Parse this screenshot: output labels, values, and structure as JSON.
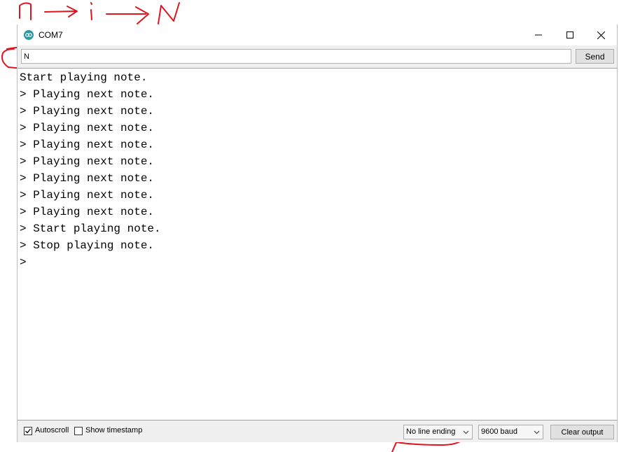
{
  "annotation": {
    "text": "n → i → N",
    "color": "#e0141e"
  },
  "window": {
    "title": "COM7",
    "icon": "arduino-icon",
    "controls": [
      "minimize-icon",
      "maximize-icon",
      "close-icon"
    ]
  },
  "input": {
    "value": "N",
    "send_label": "Send"
  },
  "output": {
    "lines": [
      "Start playing note.",
      "> Playing next note.",
      "> Playing next note.",
      "> Playing next note.",
      "> Playing next note.",
      "> Playing next note.",
      "> Playing next note.",
      "> Playing next note.",
      "> Playing next note.",
      "> Start playing note.",
      "> Stop playing note.",
      ">"
    ]
  },
  "status": {
    "autoscroll_label": "Autoscroll",
    "autoscroll_checked": true,
    "timestamp_label": "Show timestamp",
    "timestamp_checked": false,
    "line_ending": "No line ending",
    "baud": "9600 baud",
    "clear_label": "Clear output"
  }
}
